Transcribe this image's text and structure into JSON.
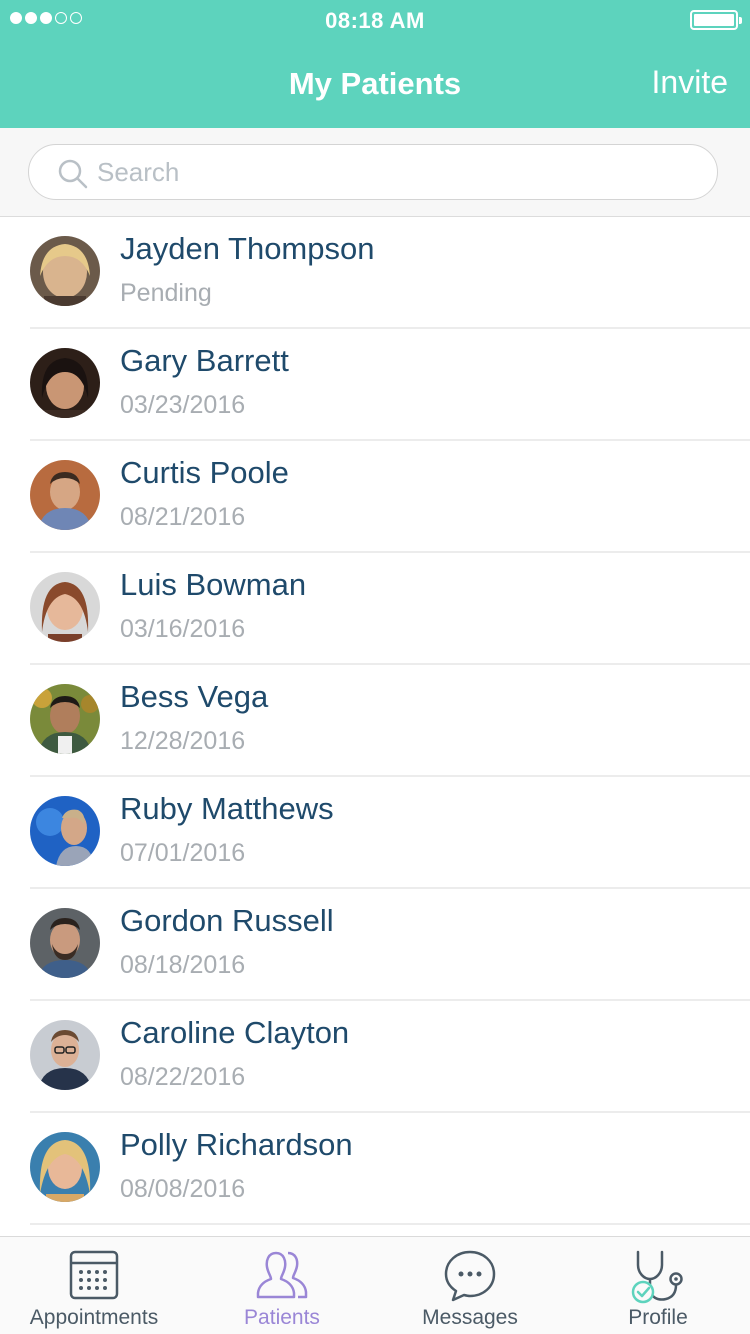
{
  "status_bar": {
    "time": "08:18 AM",
    "signal_bars": 3,
    "signal_total": 5
  },
  "header": {
    "title": "My Patients",
    "invite_label": "Invite"
  },
  "search": {
    "placeholder": "Search"
  },
  "patients": [
    {
      "name": "Jayden Thompson",
      "sub": "Pending"
    },
    {
      "name": "Gary Barrett",
      "sub": "03/23/2016"
    },
    {
      "name": "Curtis Poole",
      "sub": "08/21/2016"
    },
    {
      "name": "Luis Bowman",
      "sub": "03/16/2016"
    },
    {
      "name": "Bess Vega",
      "sub": "12/28/2016"
    },
    {
      "name": "Ruby Matthews",
      "sub": "07/01/2016"
    },
    {
      "name": "Gordon Russell",
      "sub": "08/18/2016"
    },
    {
      "name": "Caroline Clayton",
      "sub": "08/22/2016"
    },
    {
      "name": "Polly Richardson",
      "sub": "08/08/2016"
    }
  ],
  "tabs": [
    {
      "label": "Appointments",
      "icon": "calendar-icon"
    },
    {
      "label": "Patients",
      "icon": "patients-icon"
    },
    {
      "label": "Messages",
      "icon": "chat-bubble-icon"
    },
    {
      "label": "Profile",
      "icon": "stethoscope-icon"
    }
  ],
  "colors": {
    "accent": "#5dd3bd",
    "name_text": "#1f4a6b",
    "sub_text": "#a8adb2",
    "active_tab": "#9a86d6",
    "tab_icon": "#4b5a66"
  }
}
